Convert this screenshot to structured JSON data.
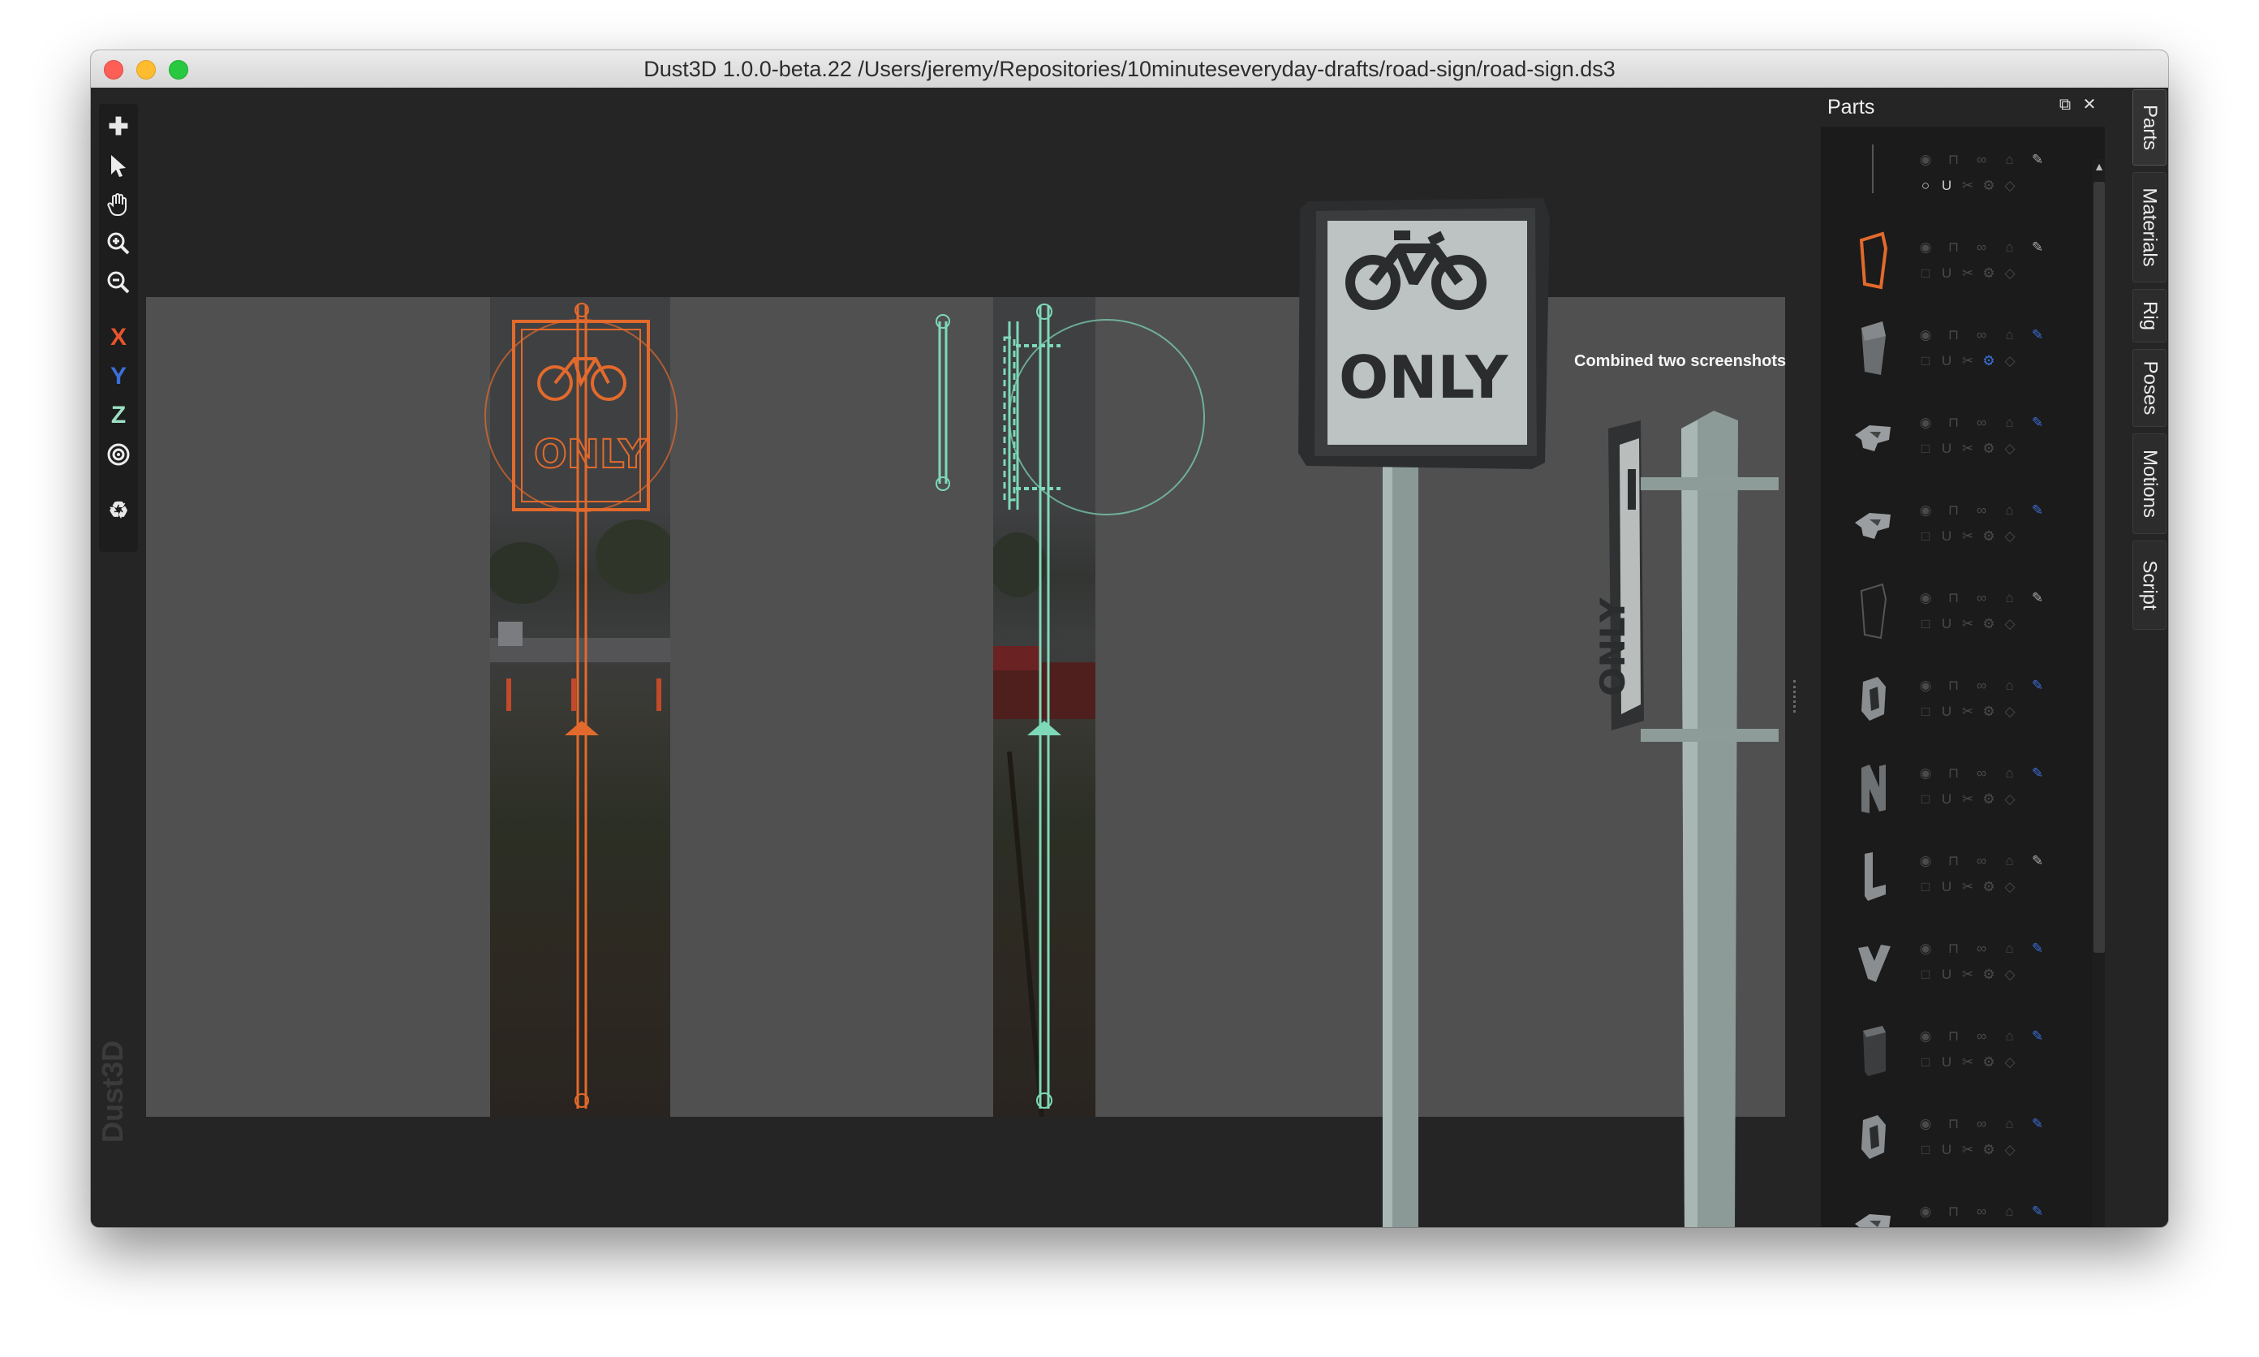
{
  "window": {
    "title": "Dust3D 1.0.0-beta.22 /Users/jeremy/Repositories/10minuteseveryday-drafts/road-sign/road-sign.ds3"
  },
  "toolbar": {
    "items": [
      {
        "name": "add-icon",
        "glyph": "✚"
      },
      {
        "name": "select-arrow-icon",
        "glyph": "➤"
      },
      {
        "name": "hand-pan-icon",
        "glyph": "✋"
      },
      {
        "name": "zoom-in-icon",
        "glyph": "⊕"
      },
      {
        "name": "zoom-out-icon",
        "glyph": "⊖"
      },
      {
        "name": "x-axis-button",
        "glyph": "X",
        "color": "#e8542d"
      },
      {
        "name": "y-axis-button",
        "glyph": "Y",
        "color": "#3b6fd8"
      },
      {
        "name": "z-axis-button",
        "glyph": "Z",
        "color": "#9de0c4"
      },
      {
        "name": "radial-icon",
        "glyph": "◎"
      },
      {
        "name": "recycle-icon",
        "glyph": "♻"
      }
    ]
  },
  "viewport": {
    "watermark": "Dust3D",
    "annotation": "Combined two screenshots",
    "sign_text": "ONLY",
    "front_color": "#e26a2c",
    "side_color": "#7ed9b8"
  },
  "parts_panel": {
    "title": "Parts",
    "float_button": "⧉",
    "close_button": "✕",
    "scroll_up": "▲",
    "scroll_down": "▼",
    "parts": [
      {
        "name": "part-pole",
        "thumb": "line"
      },
      {
        "name": "part-sign-frame",
        "thumb": "frame-selected"
      },
      {
        "name": "part-sign-board",
        "thumb": "board"
      },
      {
        "name": "part-bicycle-a",
        "thumb": "blob"
      },
      {
        "name": "part-bicycle-b",
        "thumb": "blob"
      },
      {
        "name": "part-plate",
        "thumb": "plate"
      },
      {
        "name": "part-letter-o",
        "thumb": "o"
      },
      {
        "name": "part-letter-n",
        "thumb": "n"
      },
      {
        "name": "part-letter-l",
        "thumb": "l"
      },
      {
        "name": "part-letter-y",
        "thumb": "y"
      },
      {
        "name": "part-block",
        "thumb": "block"
      },
      {
        "name": "part-ring",
        "thumb": "o"
      },
      {
        "name": "part-extra",
        "thumb": "blob"
      }
    ]
  },
  "side_tabs": [
    "Parts",
    "Materials",
    "Rig",
    "Poses",
    "Motions",
    "Script"
  ]
}
